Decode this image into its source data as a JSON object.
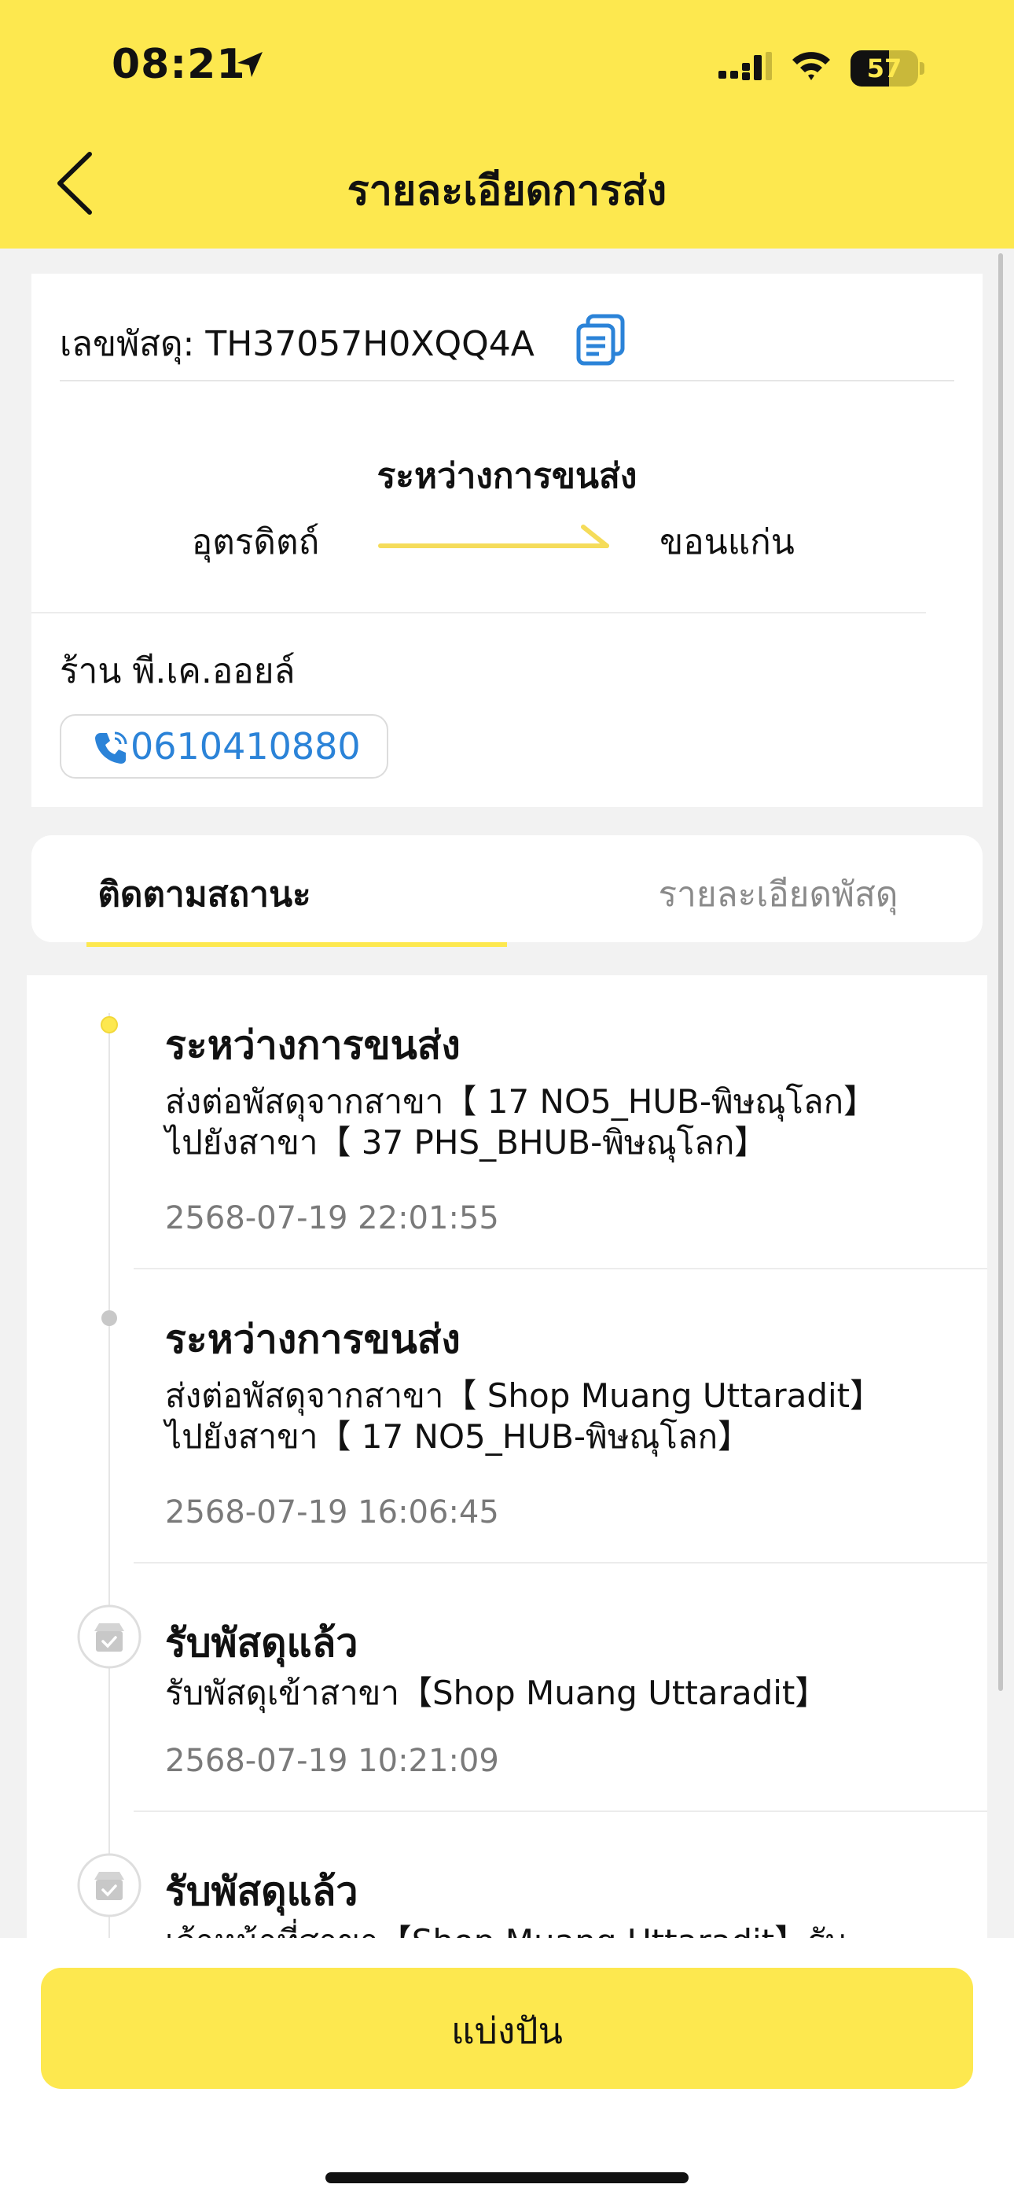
{
  "status_bar": {
    "time": "08:21",
    "battery": "57",
    "battery_level": 0.57
  },
  "header": {
    "title": "รายละเอียดการส่ง"
  },
  "parcel": {
    "tracking_label": "เลขพัสดุ: TH37057H0XQQ4A",
    "status": "ระหว่างการขนส่ง",
    "origin": "อุตรดิตถ์",
    "destination": "ขอนแก่น",
    "shop_name": "ร้าน พี.เค.ออยล์",
    "phone": "0610410880"
  },
  "tabs": {
    "tracking": "ติดตามสถานะ",
    "parcel_details": "รายละเอียดพัสดุ"
  },
  "timeline": [
    {
      "title": "ระหว่างการขนส่ง",
      "desc1": "ส่งต่อพัสดุจากสาขา【 17 NO5_HUB-พิษณุโลก】",
      "desc2": "ไปยังสาขา【 37 PHS_BHUB-พิษณุโลก】",
      "time": "2568-07-19 22:01:55"
    },
    {
      "title": "ระหว่างการขนส่ง",
      "desc1": "ส่งต่อพัสดุจากสาขา【 Shop Muang Uttaradit】",
      "desc2": "ไปยังสาขา【 17 NO5_HUB-พิษณุโลก】",
      "time": "2568-07-19 16:06:45"
    },
    {
      "title": "รับพัสดุแล้ว",
      "desc1": "รับพัสดุเข้าสาขา【Shop Muang Uttaradit】",
      "time": "2568-07-19 10:21:09"
    },
    {
      "title": "รับพัสดุแล้ว",
      "desc1": "เจ้าหน้าที่สาขา【Shop Muang Uttaradit】รับ"
    }
  ],
  "footer": {
    "share_label": "แบ่งปัน"
  },
  "colors": {
    "accent": "#fde84f",
    "link": "#2b83d8",
    "muted": "#7a7a7a"
  }
}
